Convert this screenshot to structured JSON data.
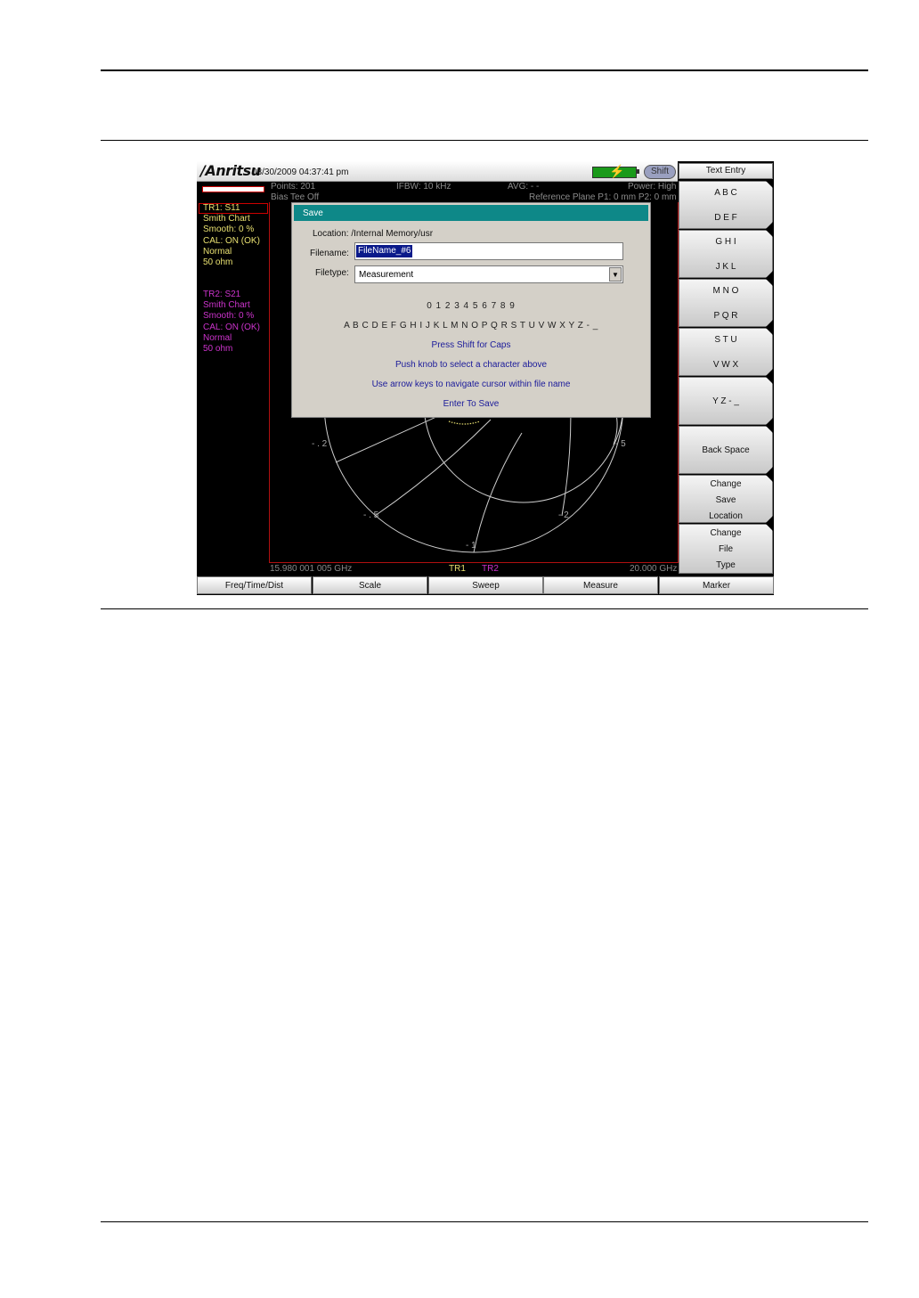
{
  "window": {
    "logo": "/Anritsu",
    "datetime": "03/30/2009 04:37:41 pm",
    "shift_label": "Shift"
  },
  "status": {
    "points": "Points: 201",
    "ifbw": "IFBW: 10 kHz",
    "avg": "AVG: - -",
    "power": "Power: High",
    "bias": "Bias Tee Off",
    "ref_plane": "Reference Plane P1: 0 mm P2: 0 mm"
  },
  "traces": [
    {
      "lines": [
        "TR1: S11",
        "Smith Chart",
        "Smooth: 0 %",
        "CAL: ON (OK)",
        "Normal",
        "50 ohm"
      ],
      "color": "#e8e070"
    },
    {
      "lines": [
        "TR2: S21",
        "Smith Chart",
        "Smooth: 0 %",
        "CAL: ON (OK)",
        "Normal",
        "50 ohm"
      ],
      "color": "#cc33cc"
    }
  ],
  "dialog": {
    "title": "Save",
    "location": "Location: /Internal Memory/usr",
    "filename_label": "Filename:",
    "filename_value": "FileName_#6",
    "filetype_label": "Filetype:",
    "filetype_value": "Measurement",
    "digits": "0 1 2 3 4 5 6 7 8 9",
    "letters": "A B C D E F G H I J K L M N O P Q R S T U V W X Y Z - _",
    "hint_shift": "Press Shift for Caps",
    "hint_knob": "Push knob to select a character above",
    "hint_arrows": "Use arrow keys to navigate cursor within file name",
    "hint_enter": "Enter To Save",
    "hint_color": "#1a1a9a"
  },
  "chart_axes": {
    "neg_point2": "- . 2",
    "neg_five": "- 5",
    "neg_point5": "- . 5",
    "neg_two": "- 2",
    "neg_one": "- 1"
  },
  "footer": {
    "start_freq": "15.980 001 005 GHz",
    "tr1": "TR1",
    "tr2": "TR2",
    "stop_freq": "20.000 GHz"
  },
  "softkeys": {
    "title": "Text Entry",
    "abc": "A B C",
    "def": "D E F",
    "ghi": "G H I",
    "jkl": "J K L",
    "mno": "M N O",
    "pqr": "P Q R",
    "stu": "S T U",
    "vwx": "V W X",
    "yz": "Y Z - _",
    "backspace": "Back Space",
    "change_save_location": [
      "Change",
      "Save",
      "Location"
    ],
    "change_file_type": [
      "Change",
      "File",
      "Type"
    ]
  },
  "bottom_keys": [
    "Freq/Time/Dist",
    "Scale",
    "Sweep",
    "Measure",
    "Marker"
  ]
}
